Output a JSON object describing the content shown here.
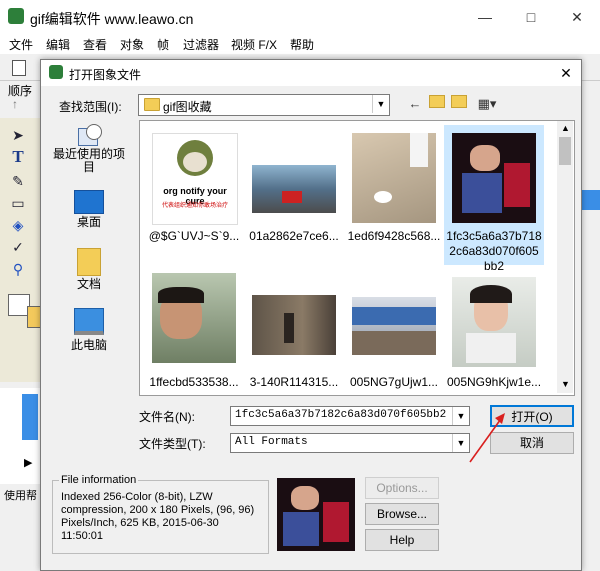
{
  "app": {
    "title": "gif编辑软件 www.leawo.cn",
    "menu": [
      "文件",
      "编辑",
      "查看",
      "对象",
      "帧",
      "过滤器",
      "视频 F/X",
      "帮助"
    ],
    "left_panel_label": "顺序",
    "status_text": "使用帮"
  },
  "dialog": {
    "title": "打开图象文件",
    "look_in_label": "查找范围(I):",
    "look_in_value": "gif图收藏",
    "places": [
      {
        "label": "最近使用的项目",
        "icon": "recent-items-icon"
      },
      {
        "label": "桌面",
        "icon": "desktop-icon"
      },
      {
        "label": "文档",
        "icon": "documents-icon"
      },
      {
        "label": "此电脑",
        "icon": "this-pc-icon"
      }
    ],
    "files": [
      {
        "name": "@$G`UVJ~S`9...",
        "thumb_text": "org notify your cure",
        "thumb_subtext": "代表组织通知你敢场治疗",
        "selected": false
      },
      {
        "name": "01a2862e7ce6...",
        "selected": false
      },
      {
        "name": "1ed6f9428c568...",
        "selected": false
      },
      {
        "name": "1fc3c5a6a37b7182c6a83d070f605bb2",
        "selected": true
      },
      {
        "name": "1ffecbd533538...",
        "selected": false
      },
      {
        "name": "3-140R114315...",
        "selected": false
      },
      {
        "name": "005NG7gUjw1...",
        "selected": false
      },
      {
        "name": "005NG9hKjw1e...",
        "selected": false
      }
    ],
    "file_name_label": "文件名(N):",
    "file_name_value": "1fc3c5a6a37b7182c6a83d070f605bb2",
    "file_type_label": "文件类型(T):",
    "file_type_value": "All Formats",
    "open_label": "打开(O)",
    "cancel_label": "取消",
    "file_info_title": "File information",
    "file_info_lines": [
      "Indexed 256-Color (8-bit), LZW",
      "compression, 200 x 180 Pixels, (96, 96)",
      "Pixels/Inch, 625 KB, 2015-06-30",
      "11:50:01"
    ],
    "options_label": "Options...",
    "browse_label": "Browse...",
    "help_label": "Help"
  },
  "colors": {
    "accent": "#0078d7",
    "selection": "#cce8ff",
    "arrow": "#d9201f"
  }
}
